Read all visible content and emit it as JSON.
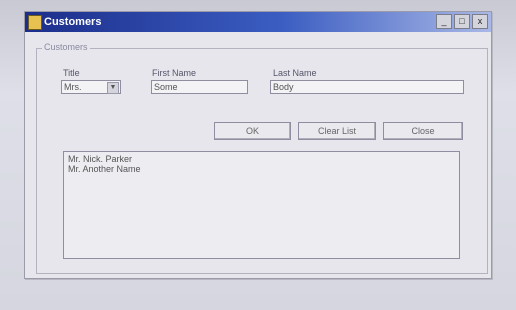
{
  "window": {
    "title": "Customers",
    "controls": [
      "_",
      "□",
      "x"
    ]
  },
  "group": {
    "label": "Customers"
  },
  "form": {
    "title_label": "Title",
    "title_value": "Mrs.",
    "first_name_label": "First Name",
    "first_name_value": "Some",
    "last_name_label": "Last Name",
    "last_name_value": "Body"
  },
  "buttons": {
    "ok": "OK",
    "clear_list": "Clear List",
    "close": "Close"
  },
  "list": {
    "items": [
      "Mr. Nick. Parker",
      "Mr. Another Name"
    ]
  }
}
